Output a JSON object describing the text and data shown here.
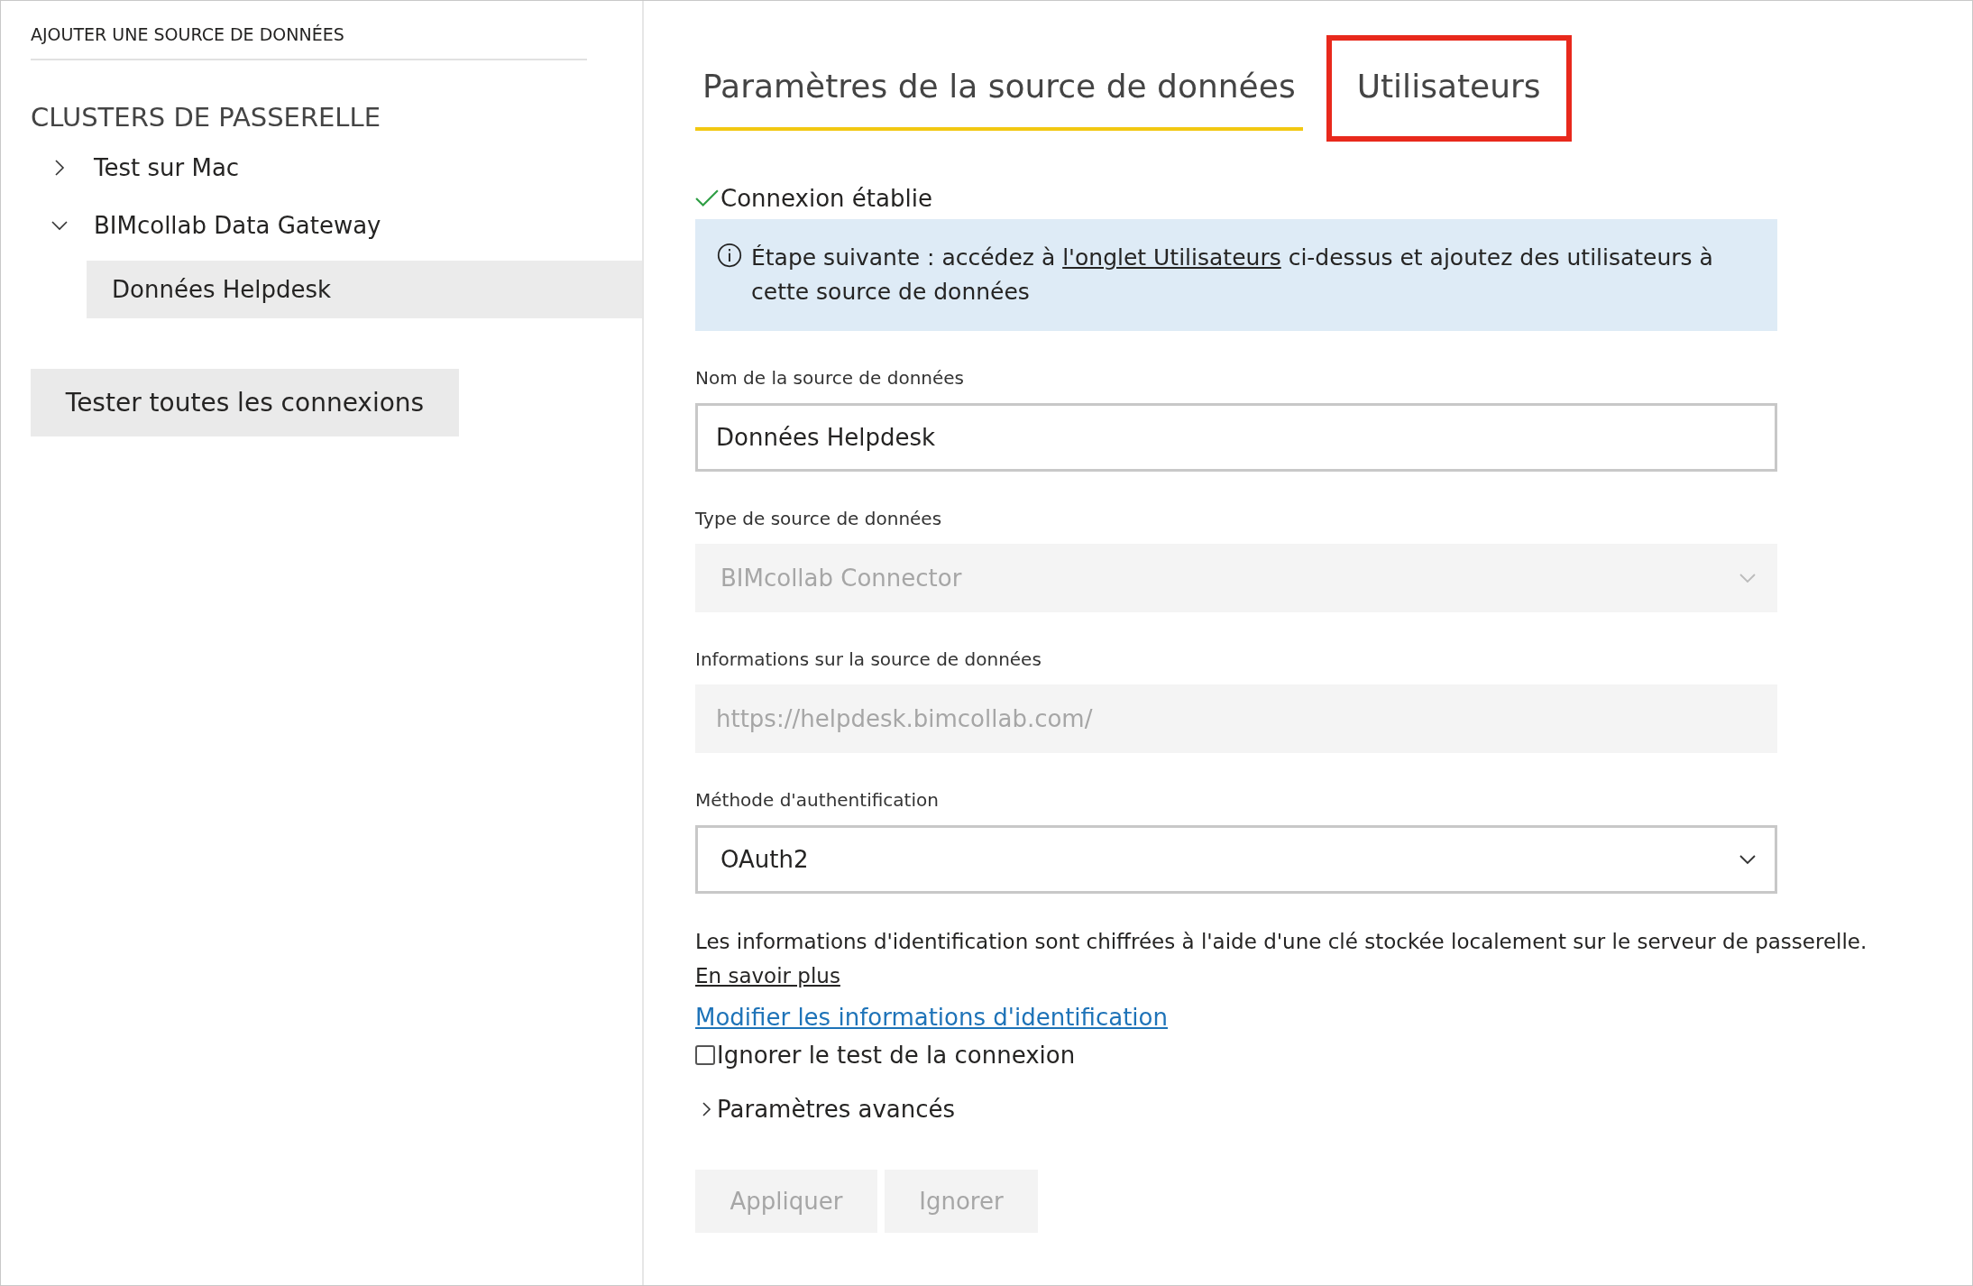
{
  "header": {
    "title": "AJOUTER UNE SOURCE DE DONNÉES"
  },
  "sidebar": {
    "section_title": "CLUSTERS DE PASSERELLE",
    "tree": [
      {
        "label": "Test sur Mac",
        "expanded": false,
        "selected": false
      },
      {
        "label": "BIMcollab Data Gateway",
        "expanded": true,
        "selected": false,
        "children": [
          {
            "label": "Données Helpdesk",
            "selected": true
          }
        ]
      }
    ],
    "test_button": "Tester toutes les connexions"
  },
  "tabs": [
    {
      "label": "Paramètres de la source de données",
      "selected": true,
      "highlighted": false
    },
    {
      "label": "Utilisateurs",
      "selected": false,
      "highlighted": true
    }
  ],
  "status": {
    "text": "Connexion établie",
    "ok": true
  },
  "info": {
    "before": "Étape suivante : accédez à ",
    "link": "l'onglet Utilisateurs",
    "after": " ci-dessus et ajoutez des utilisateurs à cette source de données"
  },
  "fields": [
    {
      "kind": "text",
      "label": "Nom de la source de données",
      "value": "Données Helpdesk",
      "disabled": false
    },
    {
      "kind": "select",
      "label": "Type de source de données",
      "value": "BIMcollab Connector",
      "disabled": true
    },
    {
      "kind": "text",
      "label": "Informations sur la source de données",
      "value": "https://helpdesk.bimcollab.com/",
      "disabled": true
    },
    {
      "kind": "select",
      "label": "Méthode d'authentification",
      "value": "OAuth2",
      "disabled": false
    }
  ],
  "credentials_note": {
    "text": "Les informations d'identification sont chiffrées à l'aide d'une clé stockée localement sur le serveur de passerelle.",
    "link": "En savoir plus"
  },
  "edit_link": "Modifier les informations d'identification",
  "skip_test": {
    "label": "Ignorer le test de la connexion",
    "checked": false
  },
  "advanced": {
    "label": "Paramètres avancés",
    "expanded": false
  },
  "buttons": [
    {
      "label": "Appliquer",
      "disabled": true
    },
    {
      "label": "Ignorer",
      "disabled": true
    }
  ]
}
